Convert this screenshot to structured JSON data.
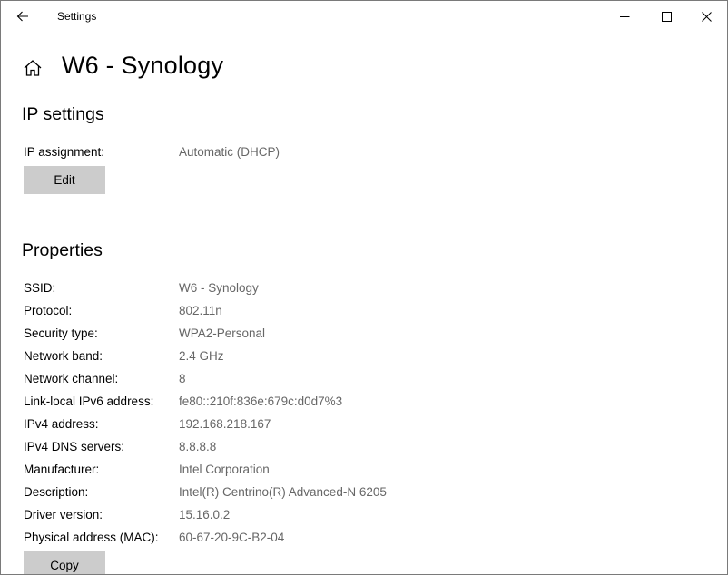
{
  "window": {
    "title": "Settings"
  },
  "header": {
    "title": "W6 - Synology"
  },
  "ip_settings": {
    "heading": "IP settings",
    "assignment_label": "IP assignment:",
    "assignment_value": "Automatic (DHCP)",
    "edit_label": "Edit"
  },
  "properties": {
    "heading": "Properties",
    "rows": [
      {
        "label": "SSID:",
        "value": "W6 - Synology"
      },
      {
        "label": "Protocol:",
        "value": "802.11n"
      },
      {
        "label": "Security type:",
        "value": "WPA2-Personal"
      },
      {
        "label": "Network band:",
        "value": "2.4 GHz"
      },
      {
        "label": "Network channel:",
        "value": "8"
      },
      {
        "label": "Link-local IPv6 address:",
        "value": "fe80::210f:836e:679c:d0d7%3"
      },
      {
        "label": "IPv4 address:",
        "value": "192.168.218.167"
      },
      {
        "label": "IPv4 DNS servers:",
        "value": "8.8.8.8"
      },
      {
        "label": "Manufacturer:",
        "value": "Intel Corporation"
      },
      {
        "label": "Description:",
        "value": "Intel(R) Centrino(R) Advanced-N 6205"
      },
      {
        "label": "Driver version:",
        "value": "15.16.0.2"
      },
      {
        "label": "Physical address (MAC):",
        "value": "60-67-20-9C-B2-04"
      }
    ],
    "copy_label": "Copy"
  },
  "icons": {
    "back": "back-arrow-icon",
    "home": "home-icon",
    "minimize": "minimize-icon",
    "maximize": "maximize-icon",
    "close": "close-icon"
  }
}
